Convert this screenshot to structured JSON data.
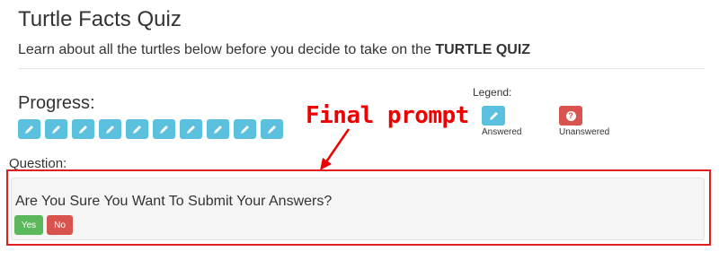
{
  "header": {
    "title": "Turtle Facts Quiz",
    "subtitle_prefix": "Learn about all the turtles below before you decide to take on the ",
    "subtitle_bold": "TURTLE QUIZ"
  },
  "progress": {
    "label": "Progress:",
    "items": [
      {
        "state": "answered",
        "icon": "pencil-icon"
      },
      {
        "state": "answered",
        "icon": "pencil-icon"
      },
      {
        "state": "answered",
        "icon": "pencil-icon"
      },
      {
        "state": "answered",
        "icon": "pencil-icon"
      },
      {
        "state": "answered",
        "icon": "pencil-icon"
      },
      {
        "state": "answered",
        "icon": "pencil-icon"
      },
      {
        "state": "answered",
        "icon": "pencil-icon"
      },
      {
        "state": "answered",
        "icon": "pencil-icon"
      },
      {
        "state": "answered",
        "icon": "pencil-icon"
      },
      {
        "state": "answered",
        "icon": "pencil-icon"
      }
    ]
  },
  "legend": {
    "label": "Legend:",
    "answered": {
      "label": "Answered",
      "icon": "pencil-icon",
      "color": "#5bc0de"
    },
    "unanswered": {
      "label": "Unanswered",
      "icon": "question-icon",
      "glyph": "?",
      "color": "#d9534f"
    }
  },
  "annotation": {
    "text": "Final prompt",
    "color": "#ee0000"
  },
  "question": {
    "label": "Question:",
    "text": "Are You Sure You Want To Submit Your Answers?",
    "yes_label": "Yes",
    "no_label": "No",
    "yes_color": "#5cb85c",
    "no_color": "#d9534f"
  }
}
